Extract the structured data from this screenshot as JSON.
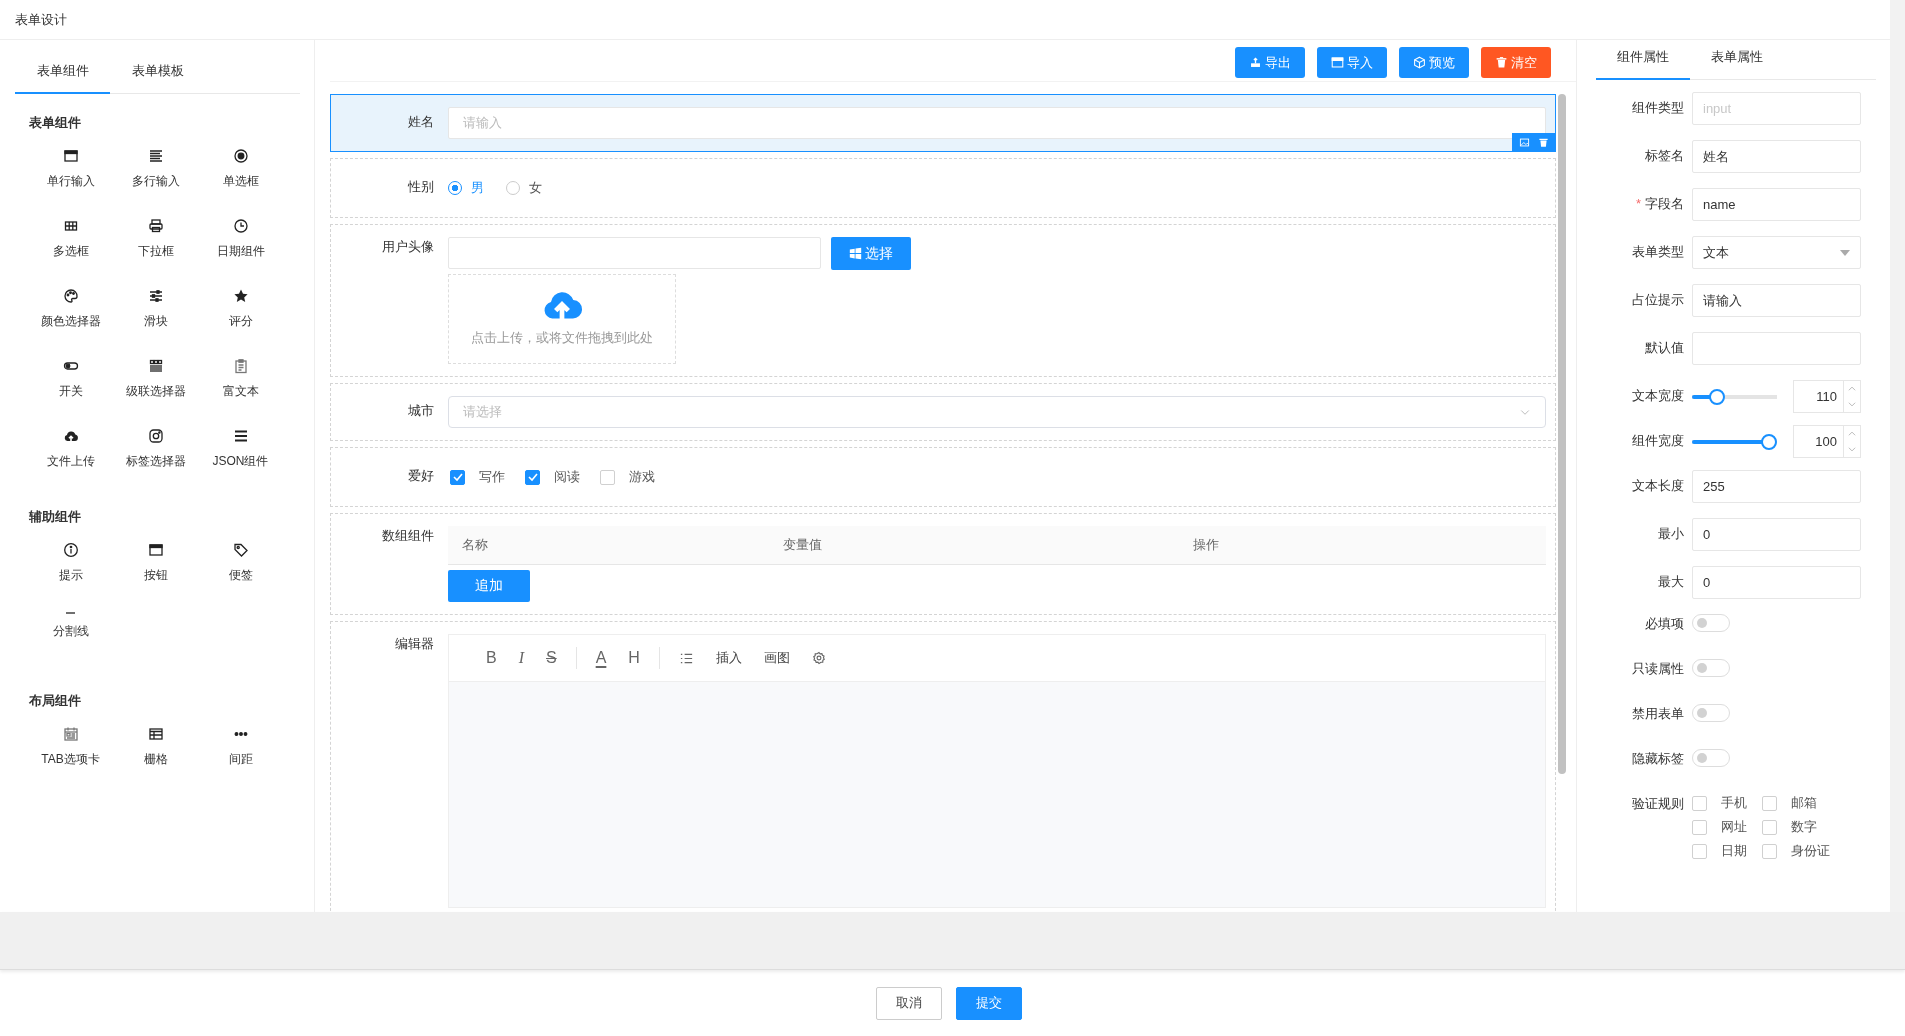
{
  "header": {
    "title": "表单设计"
  },
  "palette": {
    "tabs": [
      {
        "label": "表单组件",
        "selected": true
      },
      {
        "label": "表单模板",
        "selected": false
      }
    ],
    "groups": [
      {
        "title": "表单组件",
        "items": [
          {
            "label": "单行输入"
          },
          {
            "label": "多行输入"
          },
          {
            "label": "单选框"
          },
          {
            "label": "多选框"
          },
          {
            "label": "下拉框"
          },
          {
            "label": "日期组件"
          },
          {
            "label": "颜色选择器"
          },
          {
            "label": "滑块"
          },
          {
            "label": "评分"
          },
          {
            "label": "开关"
          },
          {
            "label": "级联选择器"
          },
          {
            "label": "富文本"
          },
          {
            "label": "文件上传"
          },
          {
            "label": "标签选择器"
          },
          {
            "label": "JSON组件"
          }
        ]
      },
      {
        "title": "辅助组件",
        "items": [
          {
            "label": "提示"
          },
          {
            "label": "按钮"
          },
          {
            "label": "便签"
          },
          {
            "label": "分割线"
          }
        ]
      },
      {
        "title": "布局组件",
        "items": [
          {
            "label": "TAB选项卡"
          },
          {
            "label": "栅格"
          },
          {
            "label": "间距"
          }
        ]
      }
    ]
  },
  "toolbar": [
    {
      "label": "导出",
      "kind": "primary"
    },
    {
      "label": "导入",
      "kind": "primary"
    },
    {
      "label": "预览",
      "kind": "primary"
    },
    {
      "label": "清空",
      "kind": "danger"
    }
  ],
  "form": {
    "fields": [
      {
        "kind": "input",
        "label": "姓名",
        "placeholder": "请输入",
        "selected": true
      },
      {
        "kind": "radio",
        "label": "性别",
        "selected": false,
        "options": [
          {
            "label": "男",
            "selected": true
          },
          {
            "label": "女",
            "selected": false
          }
        ]
      },
      {
        "kind": "upload",
        "label": "用户头像",
        "selected": false,
        "button": "选择",
        "hint": "点击上传，或将文件拖拽到此处"
      },
      {
        "kind": "select",
        "label": "城市",
        "placeholder": "请选择",
        "selected": false
      },
      {
        "kind": "checkbox",
        "label": "爱好",
        "selected": false,
        "options": [
          {
            "label": "写作",
            "checked": true
          },
          {
            "label": "阅读",
            "checked": true
          },
          {
            "label": "游戏",
            "checked": false
          }
        ]
      },
      {
        "kind": "table",
        "label": "数组组件",
        "selected": false,
        "columns": [
          "名称",
          "变量值",
          "操作"
        ],
        "button": "追加"
      },
      {
        "kind": "editor",
        "label": "编辑器",
        "selected": false,
        "tools": [
          {
            "kind": "bold",
            "label": "B"
          },
          {
            "kind": "italic",
            "label": "I"
          },
          {
            "kind": "strike",
            "label": "S"
          },
          {
            "kind": "color",
            "label": "A"
          },
          {
            "kind": "heading",
            "label": "H"
          },
          {
            "kind": "list"
          },
          {
            "kind": "text",
            "label": "插入"
          },
          {
            "kind": "text",
            "label": "画图"
          },
          {
            "kind": "settings"
          }
        ]
      }
    ]
  },
  "properties": {
    "tabs": [
      {
        "label": "组件属性",
        "selected": true
      },
      {
        "label": "表单属性",
        "selected": false
      }
    ],
    "rows": [
      {
        "kind": "input",
        "label": "组件类型",
        "placeholder": "input"
      },
      {
        "kind": "input",
        "label": "标签名",
        "value": "姓名"
      },
      {
        "kind": "input",
        "label": "字段名",
        "value": "name",
        "required_mark": "*"
      },
      {
        "kind": "select",
        "label": "表单类型",
        "value": "文本"
      },
      {
        "kind": "input",
        "label": "占位提示",
        "value": "请输入"
      },
      {
        "kind": "input",
        "label": "默认值"
      },
      {
        "kind": "slider",
        "label": "文本宽度",
        "level": 0.25,
        "value": "110"
      },
      {
        "kind": "slider",
        "label": "组件宽度",
        "level": 1,
        "value": "100"
      },
      {
        "kind": "input",
        "label": "文本长度",
        "value": "255"
      },
      {
        "kind": "input",
        "label": "最小",
        "value": "0"
      },
      {
        "kind": "input",
        "label": "最大",
        "value": "0"
      },
      {
        "kind": "switch",
        "label": "必填项",
        "on": false
      },
      {
        "kind": "switch",
        "label": "只读属性",
        "on": false
      },
      {
        "kind": "switch",
        "label": "禁用表单",
        "on": false
      },
      {
        "kind": "switch",
        "label": "隐藏标签",
        "on": false
      },
      {
        "kind": "checks",
        "label": "验证规则",
        "options": [
          {
            "label": "手机",
            "checked": false
          },
          {
            "label": "邮箱",
            "checked": false
          },
          {
            "label": "网址",
            "checked": false
          },
          {
            "label": "数字",
            "checked": false
          },
          {
            "label": "日期",
            "checked": false
          },
          {
            "label": "身份证",
            "checked": false
          }
        ]
      }
    ]
  },
  "footer": {
    "buttons": [
      {
        "label": "取消",
        "kind": "default"
      },
      {
        "label": "提交",
        "kind": "primary"
      }
    ]
  }
}
